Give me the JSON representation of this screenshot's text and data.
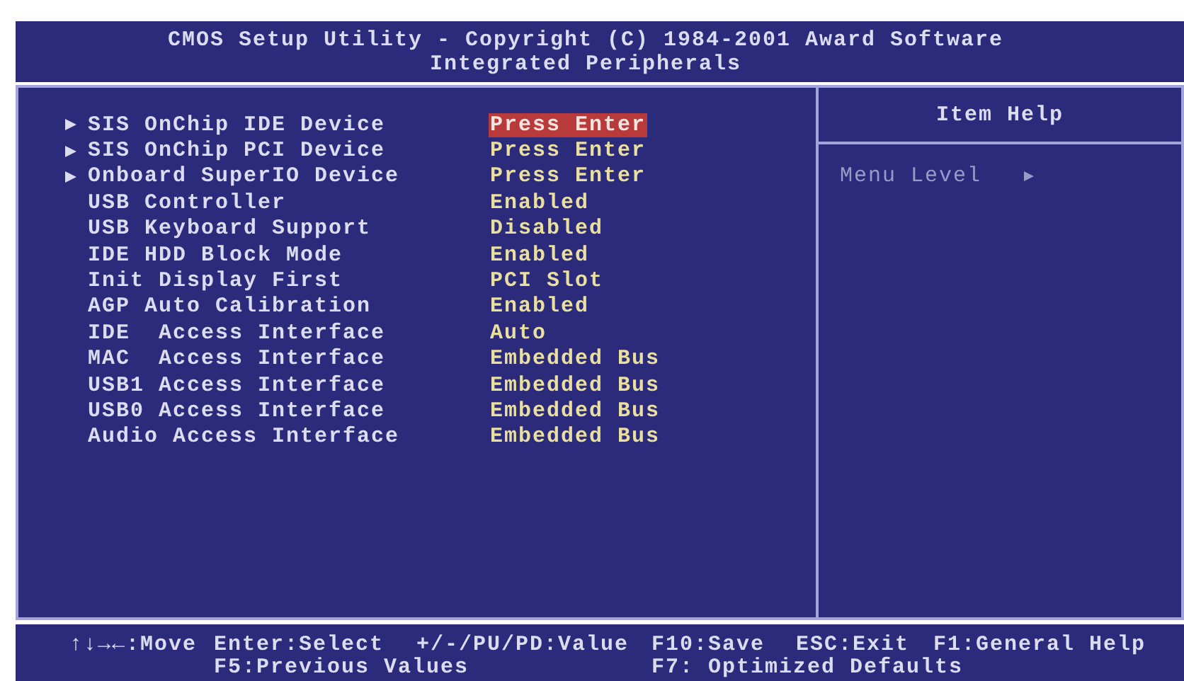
{
  "header": {
    "title": "CMOS Setup Utility - Copyright (C) 1984-2001 Award Software",
    "subtitle": "Integrated Peripherals"
  },
  "items": [
    {
      "label": "SIS OnChip IDE Device",
      "value": "Press Enter",
      "kind": "submenu",
      "selected": true
    },
    {
      "label": "SIS OnChip PCI Device",
      "value": "Press Enter",
      "kind": "submenu",
      "selected": false
    },
    {
      "label": "Onboard SuperIO Device",
      "value": "Press Enter",
      "kind": "submenu",
      "selected": false
    },
    {
      "label": "USB Controller",
      "value": "Enabled",
      "kind": "setting",
      "selected": false
    },
    {
      "label": "USB Keyboard Support",
      "value": "Disabled",
      "kind": "setting",
      "selected": false
    },
    {
      "label": "IDE HDD Block Mode",
      "value": "Enabled",
      "kind": "setting",
      "selected": false
    },
    {
      "label": "Init Display First",
      "value": "PCI Slot",
      "kind": "setting",
      "selected": false
    },
    {
      "label": "AGP Auto Calibration",
      "value": "Enabled",
      "kind": "setting",
      "selected": false
    },
    {
      "label": "IDE  Access Interface",
      "value": "Auto",
      "kind": "setting",
      "selected": false
    },
    {
      "label": "MAC  Access Interface",
      "value": "Embedded Bus",
      "kind": "setting",
      "selected": false
    },
    {
      "label": "USB1 Access Interface",
      "value": "Embedded Bus",
      "kind": "setting",
      "selected": false
    },
    {
      "label": "USB0 Access Interface",
      "value": "Embedded Bus",
      "kind": "setting",
      "selected": false
    },
    {
      "label": "Audio Access Interface",
      "value": "Embedded Bus",
      "kind": "setting",
      "selected": false
    }
  ],
  "item_help": {
    "title": "Item Help",
    "menu_level_label": "Menu Level"
  },
  "footer": {
    "columns": [
      {
        "top": "↑↓→←:Move"
      },
      {
        "top": "Enter:Select",
        "bottom": "F5:Previous Values"
      },
      {
        "top": "+/-/PU/PD:Value"
      },
      {
        "top": "F10:Save",
        "bottom": "F7: Optimized Defaults"
      },
      {
        "top": "ESC:Exit"
      },
      {
        "top": "F1:General Help"
      }
    ]
  }
}
